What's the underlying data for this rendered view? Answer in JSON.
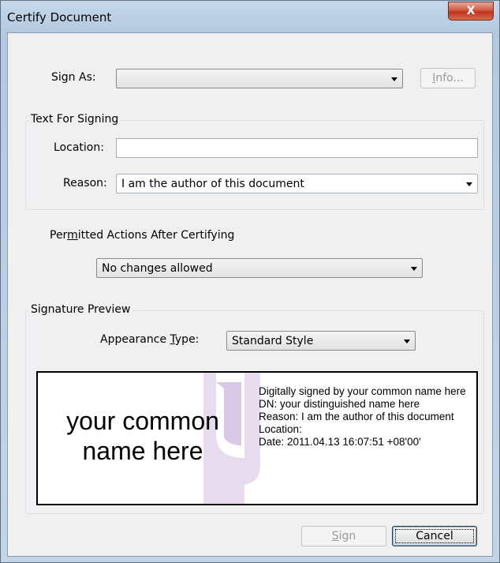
{
  "window": {
    "title": "Certify Document",
    "close_glyph": "X"
  },
  "sign_as": {
    "label_pre": "Si",
    "label_ul": "g",
    "label_post": "n As:",
    "value": "",
    "info_pre": "",
    "info_ul": "I",
    "info_post": "nfo..."
  },
  "text_for_signing": {
    "title": "Text For Signing",
    "location_label": "Location:",
    "location_value": "",
    "reason_label": "Reason:",
    "reason_value": "I am the author of this document"
  },
  "permitted": {
    "label_pre": "Per",
    "label_ul": "m",
    "label_post": "itted Actions After Certifying",
    "value": "No changes allowed"
  },
  "signature_preview": {
    "title": "Signature Preview",
    "appearance_label_pre": "Appearance ",
    "appearance_label_ul": "T",
    "appearance_label_post": "ype:",
    "appearance_value": "Standard Style",
    "name_line1": "your common",
    "name_line2": "name here",
    "details": [
      "Digitally signed by your common name here",
      "DN: your distinguished name here",
      "Reason: I am the author of this document",
      "Location:",
      "Date: 2011.04.13 16:07:51 +08'00'"
    ]
  },
  "buttons": {
    "sign_pre": "",
    "sign_ul": "S",
    "sign_post": "ign",
    "cancel": "Cancel"
  },
  "colors": {
    "watermark": "#e4d8ec",
    "close_red": "#c0331b",
    "titlebar": "#b4c9e0"
  },
  "icons": {
    "close": "close-icon",
    "dropdown": "chevron-down-icon"
  }
}
